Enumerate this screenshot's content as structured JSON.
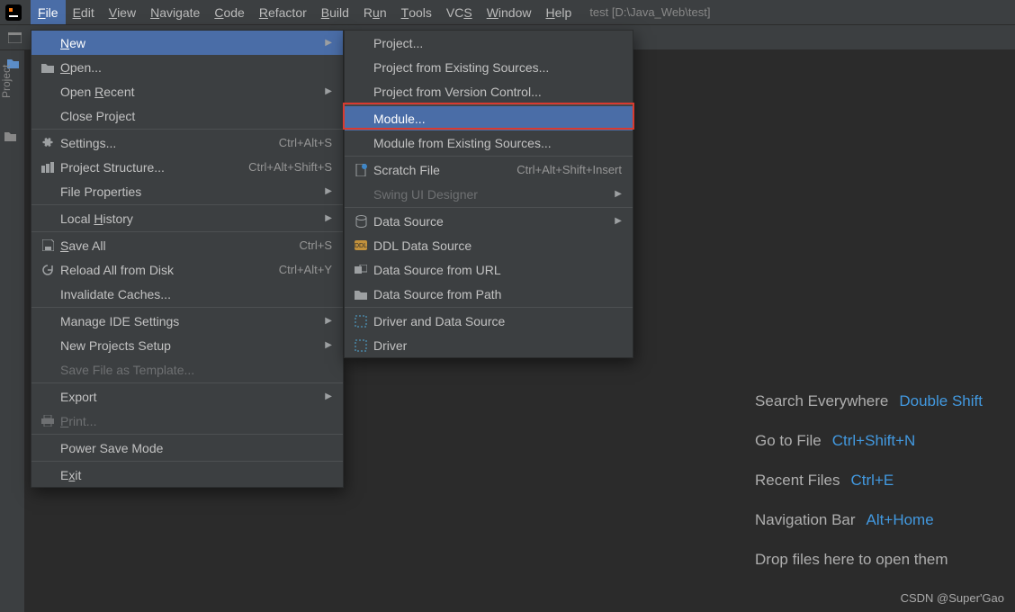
{
  "project_title": "test [D:\\Java_Web\\test]",
  "menubar": [
    "File",
    "Edit",
    "View",
    "Navigate",
    "Code",
    "Refactor",
    "Build",
    "Run",
    "Tools",
    "VCS",
    "Window",
    "Help"
  ],
  "rail_label": "Project",
  "file_menu": {
    "new": "New",
    "open": "Open...",
    "open_recent": "Open Recent",
    "close_project": "Close Project",
    "settings": "Settings...",
    "settings_sc": "Ctrl+Alt+S",
    "proj_struct": "Project Structure...",
    "proj_struct_sc": "Ctrl+Alt+Shift+S",
    "file_props": "File Properties",
    "local_hist": "Local History",
    "save_all": "Save All",
    "save_all_sc": "Ctrl+S",
    "reload": "Reload All from Disk",
    "reload_sc": "Ctrl+Alt+Y",
    "invalidate": "Invalidate Caches...",
    "manage_ide": "Manage IDE Settings",
    "new_projects": "New Projects Setup",
    "save_tpl": "Save File as Template...",
    "export": "Export",
    "print": "Print...",
    "power_save": "Power Save Mode",
    "exit": "Exit"
  },
  "new_menu": {
    "project": "Project...",
    "proj_exist": "Project from Existing Sources...",
    "proj_vcs": "Project from Version Control...",
    "module": "Module...",
    "module_exist": "Module from Existing Sources...",
    "scratch": "Scratch File",
    "scratch_sc": "Ctrl+Alt+Shift+Insert",
    "swing": "Swing UI Designer",
    "data_source": "Data Source",
    "ddl": "DDL Data Source",
    "ds_url": "Data Source from URL",
    "ds_path": "Data Source from Path",
    "driver_ds": "Driver and Data Source",
    "driver": "Driver"
  },
  "welcome": {
    "search": "Search Everywhere",
    "search_k": "Double Shift",
    "goto": "Go to File",
    "goto_k": "Ctrl+Shift+N",
    "recent": "Recent Files",
    "recent_k": "Ctrl+E",
    "nav": "Navigation Bar",
    "nav_k": "Alt+Home",
    "drop": "Drop files here to open them"
  },
  "watermark": "CSDN @Super'Gao"
}
